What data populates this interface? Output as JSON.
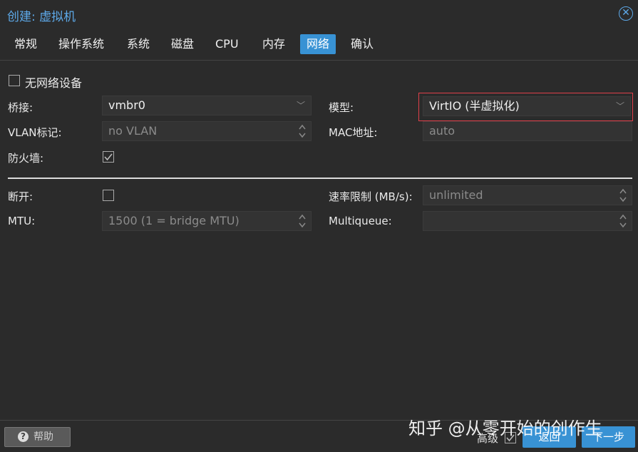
{
  "dialog": {
    "title": "创建: 虚拟机"
  },
  "tabs": [
    {
      "label": "常规"
    },
    {
      "label": "操作系统"
    },
    {
      "label": "系统"
    },
    {
      "label": "磁盘"
    },
    {
      "label": "CPU"
    },
    {
      "label": "内存"
    },
    {
      "label": "网络"
    },
    {
      "label": "确认"
    }
  ],
  "active_tab": "网络",
  "no_network": {
    "label": "无网络设备",
    "checked": false
  },
  "bridge": {
    "label": "桥接:",
    "value": "vmbr0"
  },
  "vlan": {
    "label": "VLAN标记:",
    "placeholder": "no VLAN"
  },
  "firewall": {
    "label": "防火墙:",
    "checked": true
  },
  "model": {
    "label": "模型:",
    "value": "VirtIO (半虚拟化)"
  },
  "mac": {
    "label": "MAC地址:",
    "placeholder": "auto"
  },
  "disconnect": {
    "label": "断开:",
    "checked": false
  },
  "mtu": {
    "label": "MTU:",
    "placeholder": "1500 (1 = bridge MTU)"
  },
  "rate_limit": {
    "label": "速率限制 (MB/s):",
    "placeholder": "unlimited"
  },
  "multiqueue": {
    "label": "Multiqueue:",
    "value": ""
  },
  "footer": {
    "help_label": "帮助",
    "advanced_label": "高级",
    "advanced_checked": true,
    "back_label": "返回",
    "next_label": "下一步"
  },
  "watermark": "知乎 @从零开始的创作生"
}
